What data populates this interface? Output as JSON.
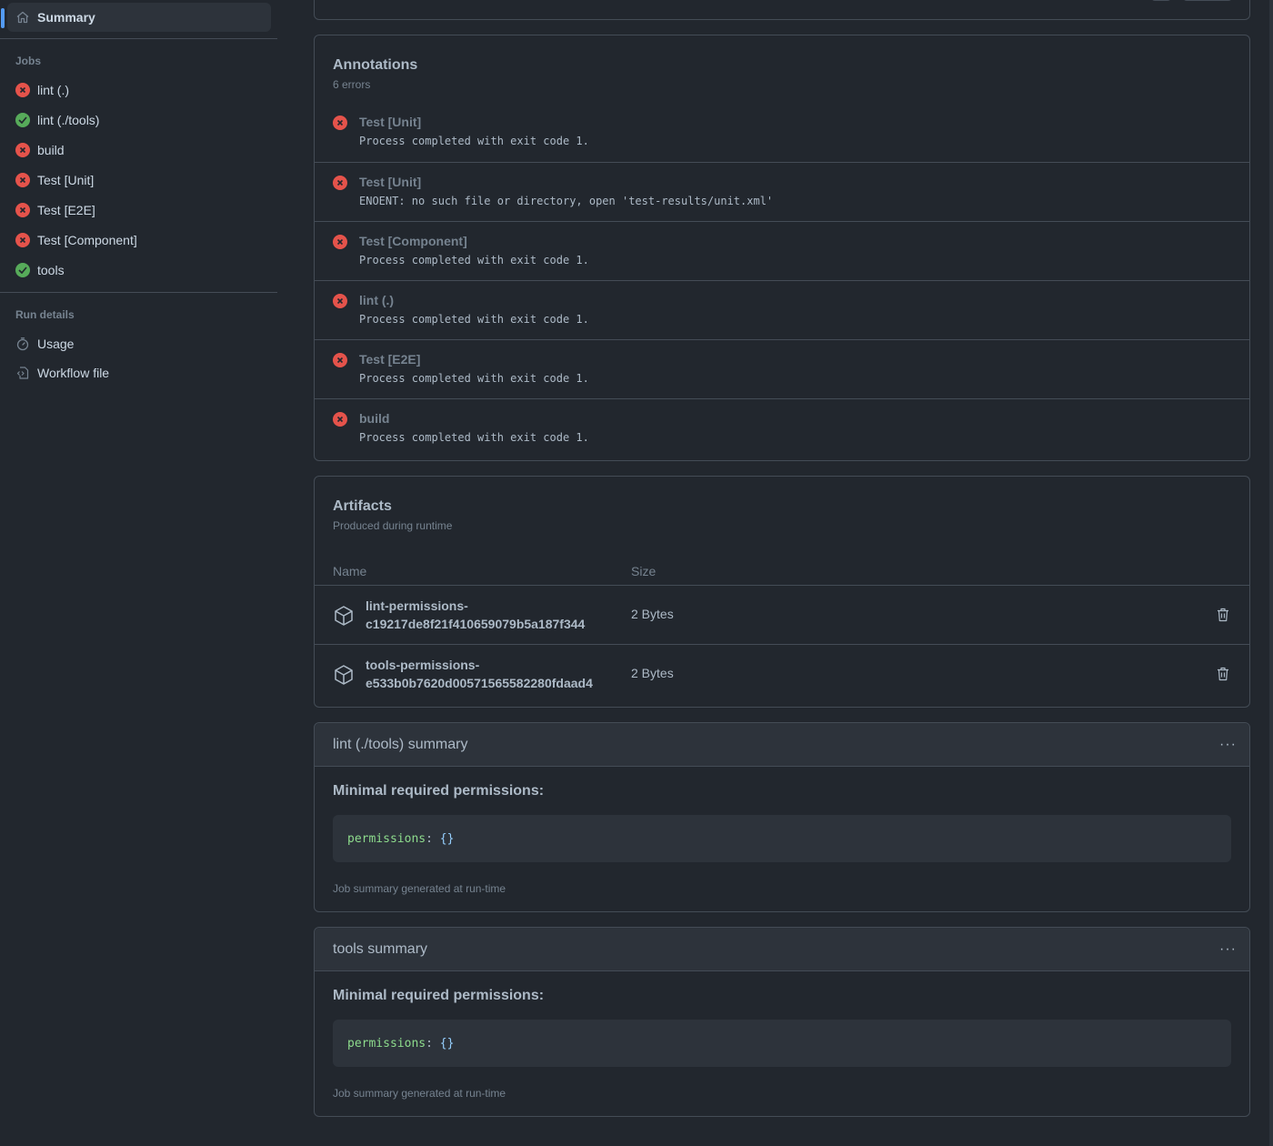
{
  "sidebar": {
    "summary_label": "Summary",
    "jobs_heading": "Jobs",
    "jobs": [
      {
        "label": "lint (.)",
        "status": "failed"
      },
      {
        "label": "lint (./tools)",
        "status": "success"
      },
      {
        "label": "build",
        "status": "failed"
      },
      {
        "label": "Test [Unit]",
        "status": "failed"
      },
      {
        "label": "Test [E2E]",
        "status": "failed"
      },
      {
        "label": "Test [Component]",
        "status": "failed"
      },
      {
        "label": "tools",
        "status": "success"
      }
    ],
    "run_details_heading": "Run details",
    "usage_label": "Usage",
    "workflow_file_label": "Workflow file"
  },
  "annotations": {
    "title": "Annotations",
    "subtitle": "6 errors",
    "items": [
      {
        "title": "Test [Unit]",
        "message": "Process completed with exit code 1."
      },
      {
        "title": "Test [Unit]",
        "message": "ENOENT: no such file or directory, open 'test-results/unit.xml'"
      },
      {
        "title": "Test [Component]",
        "message": "Process completed with exit code 1."
      },
      {
        "title": "lint (.)",
        "message": "Process completed with exit code 1."
      },
      {
        "title": "Test [E2E]",
        "message": "Process completed with exit code 1."
      },
      {
        "title": "build",
        "message": "Process completed with exit code 1."
      }
    ]
  },
  "artifacts": {
    "title": "Artifacts",
    "subtitle": "Produced during runtime",
    "col_name": "Name",
    "col_size": "Size",
    "items": [
      {
        "name_line1": "lint-permissions-",
        "name_line2": "c19217de8f21f410659079b5a187f344",
        "size": "2 Bytes"
      },
      {
        "name_line1": "tools-permissions-",
        "name_line2": "e533b0b7620d00571565582280fdaad4",
        "size": "2 Bytes"
      }
    ]
  },
  "summaries": [
    {
      "title": "lint (./tools) summary",
      "heading": "Minimal required permissions:",
      "code_key": "permissions",
      "code_sep": ": ",
      "code_value": "{}",
      "footer": "Job summary generated at run-time"
    },
    {
      "title": "tools summary",
      "heading": "Minimal required permissions:",
      "code_key": "permissions",
      "code_sep": ": ",
      "code_value": "{}",
      "footer": "Job summary generated at run-time"
    }
  ],
  "colors": {
    "background": "#22272e",
    "accent": "#539bf5",
    "failed": "#e5534b",
    "success": "#57ab5a"
  }
}
